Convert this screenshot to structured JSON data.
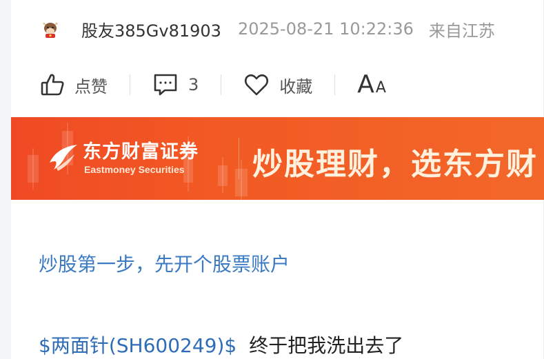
{
  "author": {
    "avatar_icon": "ox-avatar-icon",
    "username": "股友385Gv81903",
    "timestamp": "2025-08-21 10:22:36",
    "location": "来自江苏"
  },
  "actions": {
    "like_label": "点赞",
    "comment_count": "3",
    "favorite_label": "收藏",
    "font_big": "A",
    "font_small": "A"
  },
  "banner": {
    "brand_cn": "东方财富证券",
    "brand_en": "Eastmoney Securities",
    "slogan": "炒股理财，选东方财",
    "colors": {
      "start": "#f04a24",
      "end": "#f3672a"
    }
  },
  "content": {
    "promo_link": "炒股第一步，先开个股票账户",
    "stock_tag": "$两面针(SH600249)$",
    "post_text": "终于把我洗出去了"
  },
  "colors": {
    "link": "#3a7ac2",
    "muted": "#999999",
    "text": "#333333"
  }
}
